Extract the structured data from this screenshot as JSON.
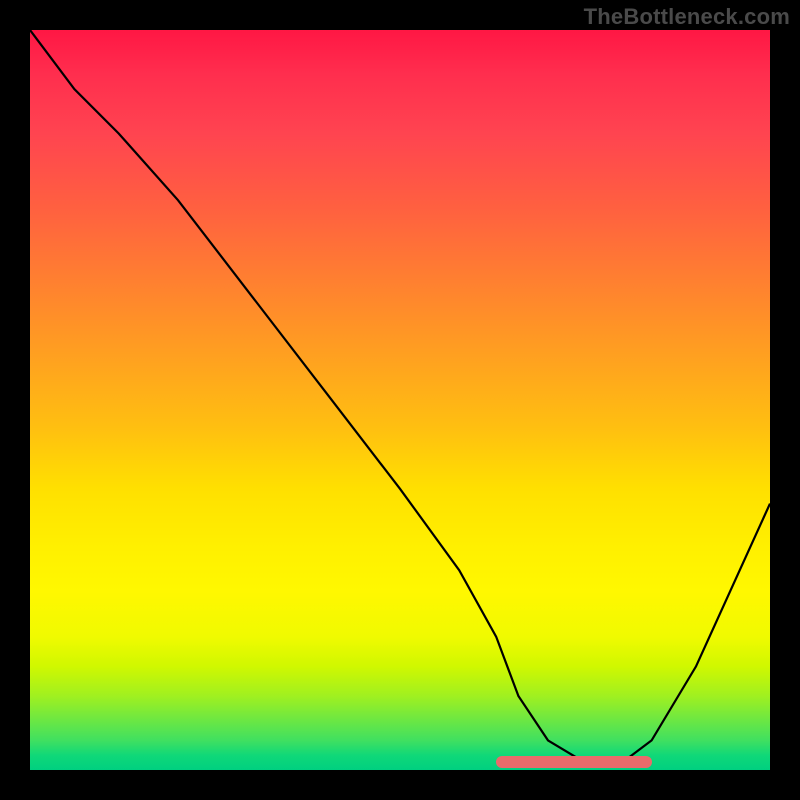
{
  "watermark": "TheBottleneck.com",
  "chart_data": {
    "type": "line",
    "title": "",
    "xlabel": "",
    "ylabel": "",
    "xlim": [
      0,
      100
    ],
    "ylim": [
      0,
      100
    ],
    "grid": false,
    "legend": false,
    "background_gradient": {
      "direction": "vertical",
      "stops": [
        {
          "pos": 0,
          "color": "#ff1744"
        },
        {
          "pos": 0.35,
          "color": "#ff8030"
        },
        {
          "pos": 0.62,
          "color": "#ffe000"
        },
        {
          "pos": 0.86,
          "color": "#d0f800"
        },
        {
          "pos": 1.0,
          "color": "#00d080"
        }
      ]
    },
    "series": [
      {
        "name": "bottleneck-curve",
        "color": "#000000",
        "x": [
          0,
          6,
          12,
          20,
          30,
          40,
          50,
          58,
          63,
          66,
          70,
          75,
          80,
          84,
          90,
          100
        ],
        "y": [
          100,
          92,
          86,
          77,
          64,
          51,
          38,
          27,
          18,
          10,
          4,
          1,
          1,
          4,
          14,
          36
        ]
      }
    ],
    "highlight_band": {
      "name": "optimal-range",
      "color": "#e96b6b",
      "x_start": 63,
      "x_end": 84,
      "y": 0
    }
  }
}
